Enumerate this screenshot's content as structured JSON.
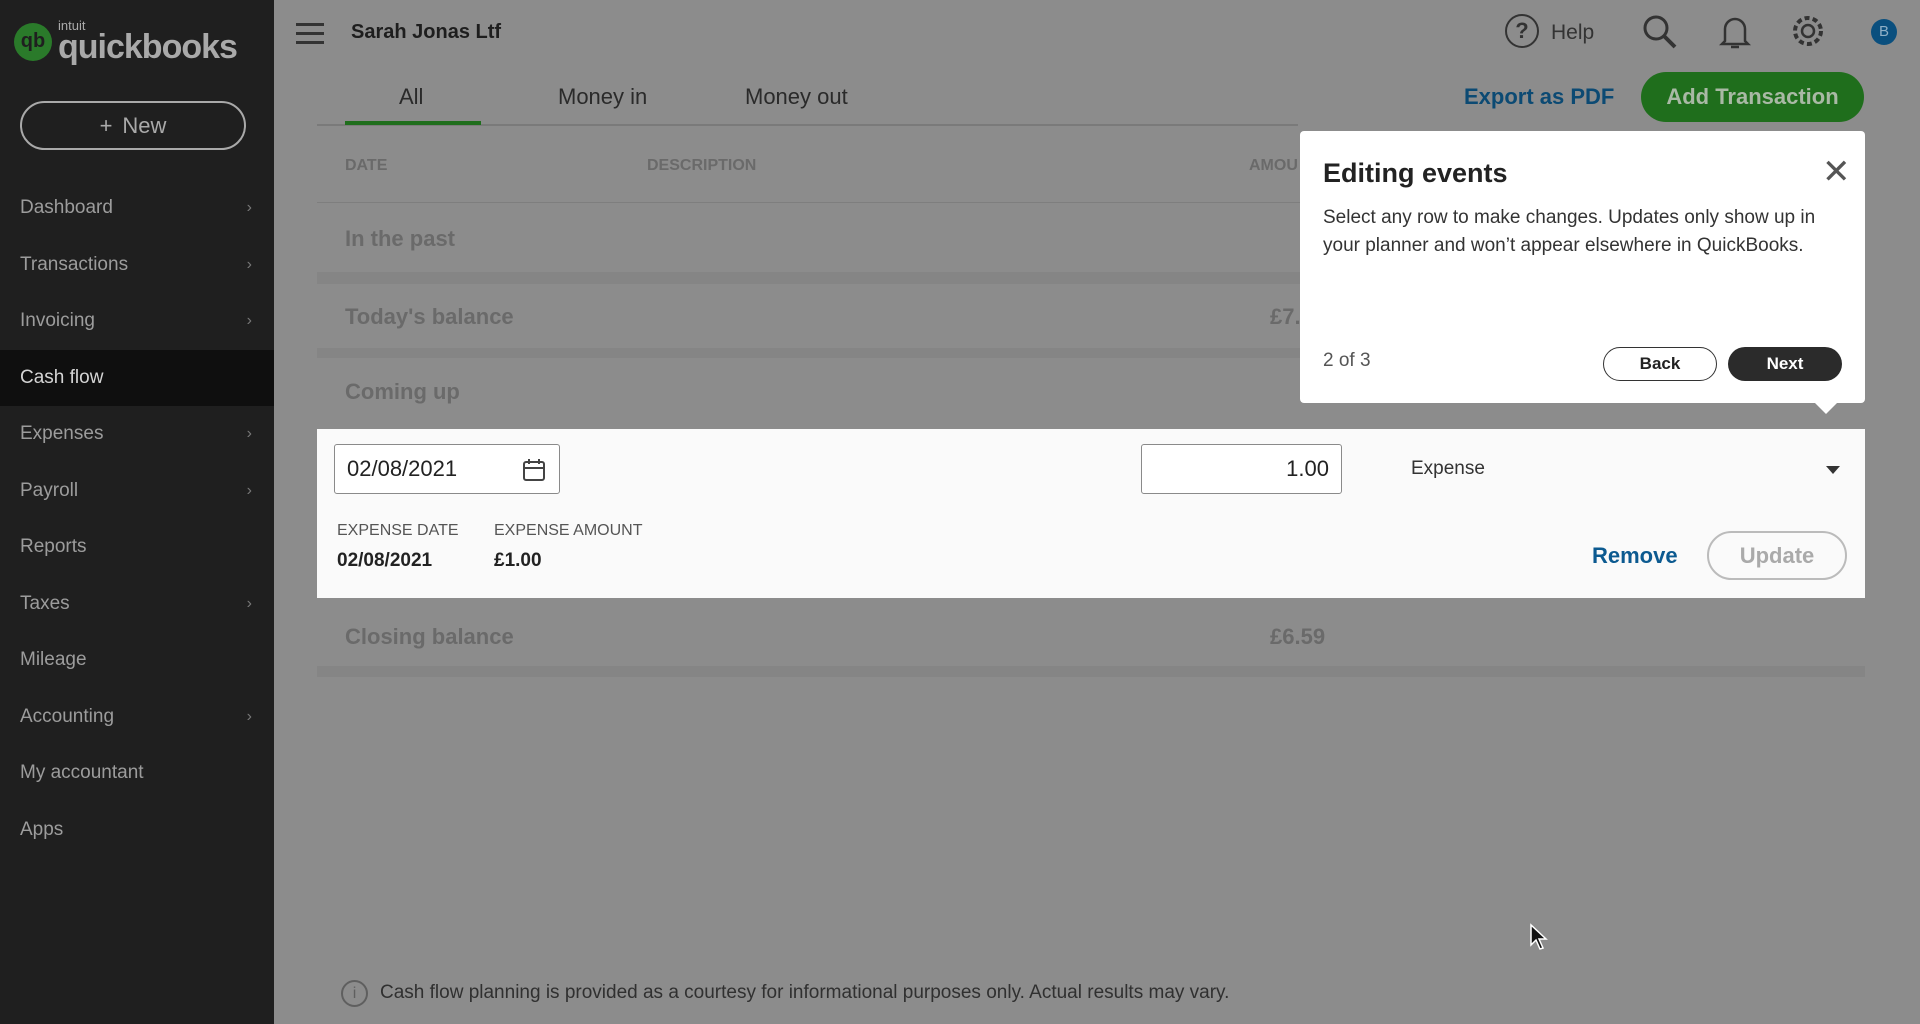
{
  "app": {
    "logo_text": "quickbooks",
    "logo_brand": "intuit",
    "company": "Sarah Jonas Ltf"
  },
  "sidebar": {
    "new_label": "New",
    "items": [
      {
        "label": "Dashboard",
        "chevron": true
      },
      {
        "label": "Transactions",
        "chevron": true
      },
      {
        "label": "Invoicing",
        "chevron": true
      },
      {
        "label": "Cash flow",
        "chevron": false,
        "active": true
      },
      {
        "label": "Expenses",
        "chevron": true
      },
      {
        "label": "Payroll",
        "chevron": true
      },
      {
        "label": "Reports",
        "chevron": false
      },
      {
        "label": "Taxes",
        "chevron": true
      },
      {
        "label": "Mileage",
        "chevron": false
      },
      {
        "label": "Accounting",
        "chevron": true
      },
      {
        "label": "My accountant",
        "chevron": false
      },
      {
        "label": "Apps",
        "chevron": false
      }
    ]
  },
  "topbar": {
    "help": "Help",
    "avatar": "B",
    "icons": [
      "menu-icon",
      "help-icon",
      "search-icon",
      "bell-icon",
      "gear-icon"
    ]
  },
  "tabs": [
    {
      "label": "All",
      "active": true
    },
    {
      "label": "Money in"
    },
    {
      "label": "Money out"
    }
  ],
  "actions": {
    "export": "Export as PDF",
    "add": "Add Transaction"
  },
  "table": {
    "headers": [
      "DATE",
      "DESCRIPTION",
      "AMOU"
    ],
    "rows": {
      "past": "In the past",
      "today": "Today's balance",
      "today_amount": "£7.",
      "coming": "Coming up",
      "closing": "Closing balance",
      "closing_amount": "£6.59"
    }
  },
  "editor": {
    "date": "02/08/2021",
    "amount": "1.00",
    "type": "Expense",
    "date_label": "EXPENSE DATE",
    "date_value": "02/08/2021",
    "amount_label": "EXPENSE AMOUNT",
    "amount_value": "£1.00",
    "remove": "Remove",
    "update": "Update"
  },
  "popover": {
    "title": "Editing events",
    "body": "Select any row to make changes. Updates only show up in your planner and won’t appear elsewhere in QuickBooks.",
    "step": "2 of 3",
    "back": "Back",
    "next": "Next"
  },
  "footer": {
    "note": "Cash flow planning is provided as a courtesy for informational purposes only. Actual results may vary."
  },
  "colors": {
    "accent_green": "#2ca01c",
    "link_blue": "#0077c5",
    "sidebar": "#1f1f1f"
  }
}
